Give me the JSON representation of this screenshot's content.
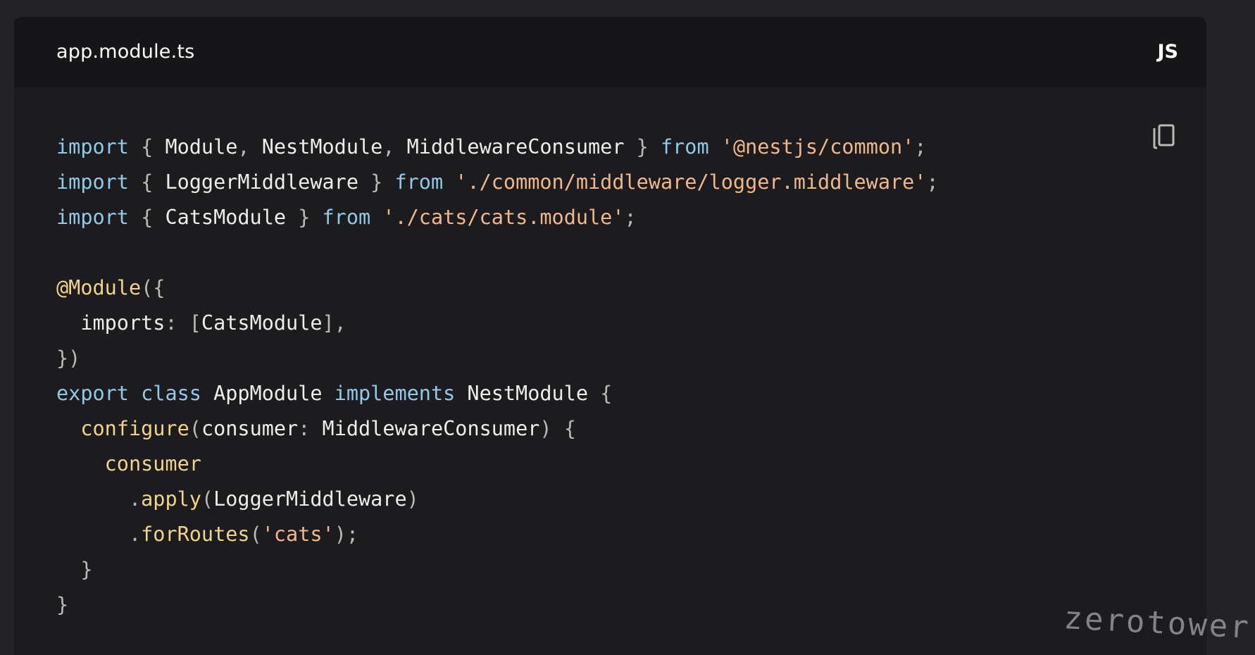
{
  "header": {
    "filename": "app.module.ts",
    "language": "JS"
  },
  "toolbar": {
    "copy_icon": "copy-icon"
  },
  "colors": {
    "keyword": "#8fcbe8",
    "string": "#f0b88a",
    "function": "#f0d48a",
    "punctuation": "#b9b9b9",
    "text": "#ededed",
    "background": "#1c1c1f",
    "header_background": "#161618"
  },
  "code": {
    "lines": [
      [
        {
          "t": "import",
          "k": "kw"
        },
        {
          "t": " { ",
          "k": "pun"
        },
        {
          "t": "Module",
          "k": "plain"
        },
        {
          "t": ", ",
          "k": "pun"
        },
        {
          "t": "NestModule",
          "k": "plain"
        },
        {
          "t": ", ",
          "k": "pun"
        },
        {
          "t": "MiddlewareConsumer",
          "k": "plain"
        },
        {
          "t": " } ",
          "k": "pun"
        },
        {
          "t": "from",
          "k": "kw"
        },
        {
          "t": " ",
          "k": "plain"
        },
        {
          "t": "'@nestjs/common'",
          "k": "str"
        },
        {
          "t": ";",
          "k": "pun"
        }
      ],
      [
        {
          "t": "import",
          "k": "kw"
        },
        {
          "t": " { ",
          "k": "pun"
        },
        {
          "t": "LoggerMiddleware",
          "k": "plain"
        },
        {
          "t": " } ",
          "k": "pun"
        },
        {
          "t": "from",
          "k": "kw"
        },
        {
          "t": " ",
          "k": "plain"
        },
        {
          "t": "'./common/middleware/logger.middleware'",
          "k": "str"
        },
        {
          "t": ";",
          "k": "pun"
        }
      ],
      [
        {
          "t": "import",
          "k": "kw"
        },
        {
          "t": " { ",
          "k": "pun"
        },
        {
          "t": "CatsModule",
          "k": "plain"
        },
        {
          "t": " } ",
          "k": "pun"
        },
        {
          "t": "from",
          "k": "kw"
        },
        {
          "t": " ",
          "k": "plain"
        },
        {
          "t": "'./cats/cats.module'",
          "k": "str"
        },
        {
          "t": ";",
          "k": "pun"
        }
      ],
      [],
      [
        {
          "t": "@Module",
          "k": "dec"
        },
        {
          "t": "({",
          "k": "pun"
        }
      ],
      [
        {
          "t": "  imports",
          "k": "plain"
        },
        {
          "t": ": [",
          "k": "pun"
        },
        {
          "t": "CatsModule",
          "k": "plain"
        },
        {
          "t": "],",
          "k": "pun"
        }
      ],
      [
        {
          "t": "})",
          "k": "pun"
        }
      ],
      [
        {
          "t": "export",
          "k": "kw"
        },
        {
          "t": " ",
          "k": "plain"
        },
        {
          "t": "class",
          "k": "kw"
        },
        {
          "t": " AppModule ",
          "k": "plain"
        },
        {
          "t": "implements",
          "k": "kw"
        },
        {
          "t": " NestModule ",
          "k": "plain"
        },
        {
          "t": "{",
          "k": "pun"
        }
      ],
      [
        {
          "t": "  ",
          "k": "plain"
        },
        {
          "t": "configure",
          "k": "fn"
        },
        {
          "t": "(",
          "k": "pun"
        },
        {
          "t": "consumer",
          "k": "plain"
        },
        {
          "t": ": ",
          "k": "pun"
        },
        {
          "t": "MiddlewareConsumer",
          "k": "plain"
        },
        {
          "t": ") {",
          "k": "pun"
        }
      ],
      [
        {
          "t": "    ",
          "k": "plain"
        },
        {
          "t": "consumer",
          "k": "fn"
        }
      ],
      [
        {
          "t": "      ",
          "k": "plain"
        },
        {
          "t": ".",
          "k": "pun"
        },
        {
          "t": "apply",
          "k": "fn"
        },
        {
          "t": "(",
          "k": "pun"
        },
        {
          "t": "LoggerMiddleware",
          "k": "plain"
        },
        {
          "t": ")",
          "k": "pun"
        }
      ],
      [
        {
          "t": "      ",
          "k": "plain"
        },
        {
          "t": ".",
          "k": "pun"
        },
        {
          "t": "forRoutes",
          "k": "fn"
        },
        {
          "t": "(",
          "k": "pun"
        },
        {
          "t": "'cats'",
          "k": "str"
        },
        {
          "t": ");",
          "k": "pun"
        }
      ],
      [
        {
          "t": "  }",
          "k": "pun"
        }
      ],
      [
        {
          "t": "}",
          "k": "pun"
        }
      ]
    ]
  },
  "watermark": "zerotower"
}
